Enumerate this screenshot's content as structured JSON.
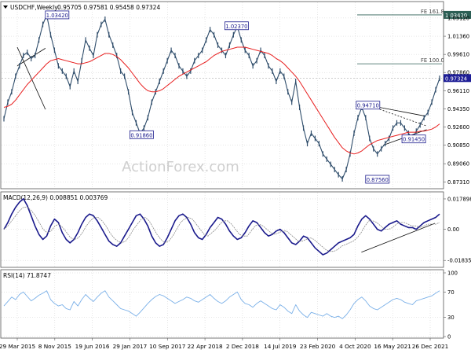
{
  "header": {
    "symbol": "USDCHF,Weekly",
    "ohlc": "0.95705 0.97581 0.95458 0.97324"
  },
  "watermark": "ActionForex.com",
  "x_labels": [
    "29 Mar 2015",
    "8 Nov 2015",
    "19 Jun 2016",
    "29 Jan 2017",
    "10 Sep 2017",
    "22 Apr 2018",
    "2 Dec 2018",
    "14 Jul 2019",
    "23 Feb 2020",
    "4 Oct 2020",
    "16 May 2021",
    "26 Dec 2021"
  ],
  "colors": {
    "price": "#2f4d6b",
    "ma": "#e82020",
    "macd": "#1a1a8c",
    "signal": "#8a8a8a",
    "rsi": "#7ab0e8",
    "fib": "#2c5f55",
    "last_price_bg": "#1e1e96",
    "grid": "#c0c0c0"
  },
  "chart_data": [
    {
      "type": "line",
      "panel": "price",
      "title": "USDCHF,Weekly",
      "ylim": [
        0.868,
        1.044
      ],
      "y_ticks": [
        "1.03120",
        "1.01360",
        "0.99610",
        "0.97860",
        "0.96110",
        "0.94350",
        "0.92600",
        "0.90850",
        "0.89060",
        "0.87310"
      ],
      "y_tick_values": [
        1.0312,
        1.0136,
        0.9961,
        0.9786,
        0.9611,
        0.9435,
        0.926,
        0.9085,
        0.8906,
        0.8731
      ],
      "last_price": {
        "label": "0.97324",
        "value": 0.97324
      },
      "fib_levels": [
        {
          "label": "FE 161.8",
          "price_label": "1.03420",
          "value": 1.0342
        },
        {
          "label": "FE 100.0",
          "value": 0.987
        }
      ],
      "annotations": [
        {
          "label": "1.03420",
          "x": "2015-11-22",
          "y": 1.0342
        },
        {
          "label": "1.02370",
          "x": "2018-10-28",
          "y": 1.0237
        },
        {
          "label": "0.91860",
          "x": "2017-04-09",
          "y": 0.9186
        },
        {
          "label": "0.94710",
          "x": "2020-12-20",
          "y": 0.9471
        },
        {
          "label": "0.87560",
          "x": "2021-02-14",
          "y": 0.8756
        },
        {
          "label": "0.91450",
          "x": "2021-09-19",
          "y": 0.9145
        }
      ],
      "series": [
        {
          "values": [
            0.934,
            0.95,
            0.96,
            0.975,
            0.985,
            0.995,
            0.998,
            0.992,
            0.995,
            1.01,
            1.025,
            1.034,
            1.015,
            1.0,
            0.985,
            0.98,
            0.975,
            0.965,
            0.98,
            0.97,
            0.99,
            1.01,
            1.002,
            0.995,
            1.015,
            1.025,
            1.03,
            1.015,
            1.005,
            0.995,
            0.98,
            0.975,
            0.96,
            0.94,
            0.93,
            0.92,
            0.925,
            0.935,
            0.95,
            0.96,
            0.97,
            0.98,
            0.99,
            1.0,
            0.995,
            0.985,
            0.98,
            0.975,
            0.98,
            0.99,
            0.995,
            1.0,
            1.01,
            1.02,
            1.015,
            1.005,
            1.0,
            0.995,
            1.005,
            1.015,
            1.023,
            1.01,
            1.0,
            0.995,
            0.985,
            0.99,
            1.0,
            0.995,
            0.985,
            0.98,
            0.97,
            0.98,
            0.975,
            0.96,
            0.95,
            0.97,
            0.945,
            0.925,
            0.91,
            0.92,
            0.915,
            0.91,
            0.9,
            0.895,
            0.89,
            0.885,
            0.88,
            0.876,
            0.885,
            0.9,
            0.92,
            0.935,
            0.945,
            0.935,
            0.915,
            0.905,
            0.9,
            0.905,
            0.91,
            0.915,
            0.925,
            0.93,
            0.93,
            0.925,
            0.92,
            0.915,
            0.922,
            0.928,
            0.935,
            0.94,
            0.95,
            0.962,
            0.973
          ]
        },
        {
          "name": "MA",
          "values": [
            0.945,
            0.946,
            0.948,
            0.952,
            0.957,
            0.962,
            0.967,
            0.971,
            0.975,
            0.979,
            0.983,
            0.987,
            0.99,
            0.991,
            0.992,
            0.991,
            0.99,
            0.989,
            0.988,
            0.987,
            0.987,
            0.988,
            0.989,
            0.991,
            0.993,
            0.995,
            0.997,
            0.997,
            0.996,
            0.994,
            0.991,
            0.987,
            0.983,
            0.978,
            0.973,
            0.968,
            0.964,
            0.961,
            0.96,
            0.96,
            0.961,
            0.963,
            0.966,
            0.969,
            0.972,
            0.975,
            0.977,
            0.979,
            0.981,
            0.983,
            0.985,
            0.987,
            0.989,
            0.992,
            0.995,
            0.997,
            0.999,
            1.0,
            1.001,
            1.002,
            1.003,
            1.003,
            1.003,
            1.002,
            1.001,
            1.0,
            0.999,
            0.998,
            0.997,
            0.995,
            0.992,
            0.99,
            0.987,
            0.983,
            0.979,
            0.975,
            0.97,
            0.964,
            0.958,
            0.952,
            0.946,
            0.94,
            0.934,
            0.928,
            0.922,
            0.916,
            0.911,
            0.906,
            0.903,
            0.901,
            0.9,
            0.901,
            0.903,
            0.906,
            0.909,
            0.911,
            0.913,
            0.914,
            0.915,
            0.916,
            0.917,
            0.918,
            0.919,
            0.92,
            0.921,
            0.921,
            0.921,
            0.922,
            0.922,
            0.923,
            0.924,
            0.926,
            0.929
          ]
        }
      ]
    },
    {
      "type": "line",
      "panel": "macd",
      "title": "MACD(12,26,9) 0.008851 0.003769",
      "ylim": [
        -0.0215,
        0.0202
      ],
      "y_ticks": [
        "0.017898",
        "0.00",
        "-0.018354"
      ],
      "y_tick_values": [
        0.017898,
        0.0,
        -0.018354
      ],
      "series": [
        {
          "name": "MACD",
          "values": [
            0.0,
            0.004,
            0.009,
            0.013,
            0.016,
            0.018,
            0.014,
            0.008,
            0.002,
            -0.003,
            -0.006,
            -0.004,
            0.002,
            0.006,
            0.004,
            -0.002,
            -0.006,
            -0.008,
            -0.006,
            -0.002,
            0.003,
            0.007,
            0.009,
            0.008,
            0.005,
            0.001,
            -0.003,
            -0.007,
            -0.009,
            -0.01,
            -0.008,
            -0.004,
            0.0,
            0.004,
            0.008,
            0.009,
            0.006,
            0.002,
            -0.004,
            -0.008,
            -0.01,
            -0.009,
            -0.005,
            0.0,
            0.005,
            0.008,
            0.009,
            0.007,
            0.003,
            -0.002,
            -0.005,
            -0.006,
            -0.003,
            0.001,
            0.004,
            0.007,
            0.006,
            0.003,
            -0.001,
            -0.004,
            -0.006,
            -0.005,
            -0.002,
            0.002,
            0.005,
            0.004,
            0.001,
            -0.002,
            -0.004,
            -0.003,
            -0.001,
            0.0,
            -0.002,
            -0.005,
            -0.008,
            -0.009,
            -0.007,
            -0.004,
            -0.005,
            -0.008,
            -0.011,
            -0.013,
            -0.015,
            -0.014,
            -0.012,
            -0.01,
            -0.008,
            -0.007,
            -0.006,
            -0.005,
            -0.003,
            0.002,
            0.006,
            0.008,
            0.006,
            0.003,
            0.0,
            -0.001,
            0.001,
            0.003,
            0.004,
            0.005,
            0.003,
            0.002,
            0.001,
            0.001,
            0.0,
            0.002,
            0.004,
            0.005,
            0.006,
            0.007,
            0.009
          ]
        },
        {
          "name": "Signal",
          "values": [
            0.0,
            0.002,
            0.005,
            0.008,
            0.011,
            0.013,
            0.013,
            0.011,
            0.008,
            0.004,
            0.0,
            -0.002,
            -0.001,
            0.002,
            0.003,
            0.001,
            -0.002,
            -0.005,
            -0.006,
            -0.005,
            -0.002,
            0.002,
            0.005,
            0.007,
            0.007,
            0.005,
            0.002,
            -0.002,
            -0.005,
            -0.007,
            -0.008,
            -0.007,
            -0.004,
            0.0,
            0.003,
            0.006,
            0.007,
            0.005,
            0.001,
            -0.003,
            -0.006,
            -0.008,
            -0.007,
            -0.004,
            0.0,
            0.004,
            0.006,
            0.007,
            0.006,
            0.003,
            0.0,
            -0.003,
            -0.004,
            -0.002,
            0.0,
            0.003,
            0.005,
            0.005,
            0.003,
            0.0,
            -0.003,
            -0.004,
            -0.004,
            -0.001,
            0.002,
            0.003,
            0.002,
            0.0,
            -0.002,
            -0.003,
            -0.002,
            -0.001,
            -0.001,
            -0.003,
            -0.005,
            -0.007,
            -0.007,
            -0.006,
            -0.005,
            -0.006,
            -0.008,
            -0.01,
            -0.012,
            -0.013,
            -0.013,
            -0.012,
            -0.01,
            -0.009,
            -0.008,
            -0.007,
            -0.005,
            -0.002,
            0.002,
            0.005,
            0.005,
            0.004,
            0.002,
            0.0,
            0.0,
            0.001,
            0.003,
            0.004,
            0.004,
            0.003,
            0.002,
            0.002,
            0.001,
            0.002,
            0.003,
            0.003,
            0.003,
            0.004
          ]
        }
      ]
    },
    {
      "type": "line",
      "panel": "rsi",
      "title": "RSI(14) 71.8747",
      "ylim": [
        0,
        100
      ],
      "y_ticks": [
        "100",
        "70",
        "30",
        "0"
      ],
      "y_tick_values": [
        100,
        70,
        30,
        0
      ],
      "series": [
        {
          "name": "RSI",
          "values": [
            48,
            55,
            62,
            58,
            66,
            70,
            63,
            56,
            60,
            65,
            68,
            72,
            58,
            52,
            48,
            50,
            44,
            42,
            55,
            48,
            58,
            66,
            60,
            55,
            62,
            68,
            72,
            62,
            56,
            50,
            44,
            42,
            40,
            36,
            32,
            38,
            45,
            52,
            58,
            63,
            66,
            64,
            60,
            56,
            52,
            55,
            58,
            62,
            60,
            56,
            54,
            58,
            62,
            66,
            60,
            55,
            52,
            56,
            62,
            66,
            70,
            58,
            52,
            50,
            46,
            52,
            56,
            52,
            48,
            44,
            42,
            50,
            46,
            40,
            36,
            50,
            40,
            34,
            30,
            38,
            36,
            34,
            32,
            36,
            32,
            30,
            32,
            28,
            34,
            42,
            52,
            58,
            62,
            56,
            48,
            44,
            42,
            46,
            50,
            54,
            58,
            60,
            58,
            54,
            52,
            50,
            56,
            58,
            60,
            62,
            64,
            68,
            72
          ]
        }
      ]
    }
  ]
}
